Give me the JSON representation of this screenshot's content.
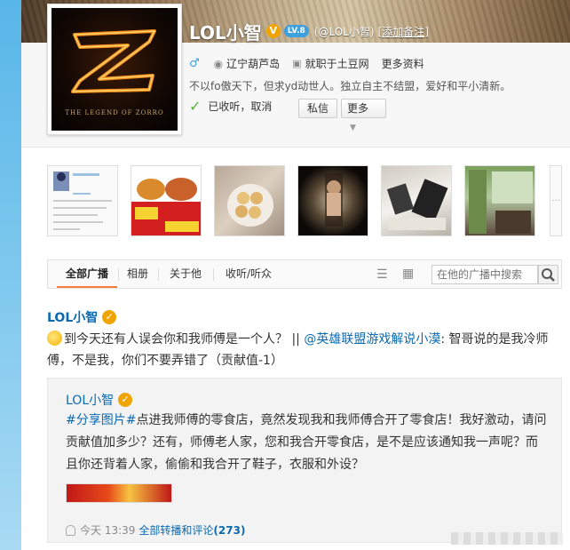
{
  "profile": {
    "name": "LOL小智",
    "verified_badge": "V",
    "level": "LV.8",
    "handle": "(@LOL小智)",
    "remark_link": "[添加备注]",
    "gender_icon": "male-icon",
    "location": "辽宁葫芦岛",
    "work": "就职于土豆网",
    "more_info": "更多资料",
    "bio": "不以fo傲天下，但求yd动世人。独立自主不结盟，爱好和平小清新。",
    "follow_status": "已收听，",
    "unfollow": "取消",
    "message_button": "私信",
    "more_button": "更多",
    "avatar_caption": "THE LEGEND OF ZORRO"
  },
  "photos": {
    "next_label": "···"
  },
  "tabs": [
    {
      "label": "全部广播"
    },
    {
      "label": "相册"
    },
    {
      "label": "关于他"
    },
    {
      "label": "收听/听众"
    }
  ],
  "search": {
    "placeholder": "在他的广播中搜索"
  },
  "post": {
    "author": "LOL小智",
    "text_before": "到今天还有人误会你和我师傅是一个人？ || ",
    "mention": "@英雄联盟游戏解说小漠",
    "text_after": ": 智哥说的是我冷师傅，不是我，你们不要弄错了（贡献值-1）"
  },
  "repost": {
    "author": "LOL小智",
    "topic1": "#分享图片",
    "topic2": "#",
    "text": "点进我师傅的零食店，竟然发现我和我师傅合开了零食店！我好激动，请问贡献值加多少？还有，师傅老人家，您和我合开零食店，是不是应该通知我一声呢？而且你还背着人家，偷偷和我合开了鞋子，衣服和外设？",
    "time": "今天 13:39",
    "comments_link": "全部转播和评论",
    "comments_count": "(273)"
  },
  "colors": {
    "link": "#0a6ab0",
    "accent_tab": "#f77c3d",
    "verified": "#f0a400",
    "left_bar": "#58b6e8"
  }
}
